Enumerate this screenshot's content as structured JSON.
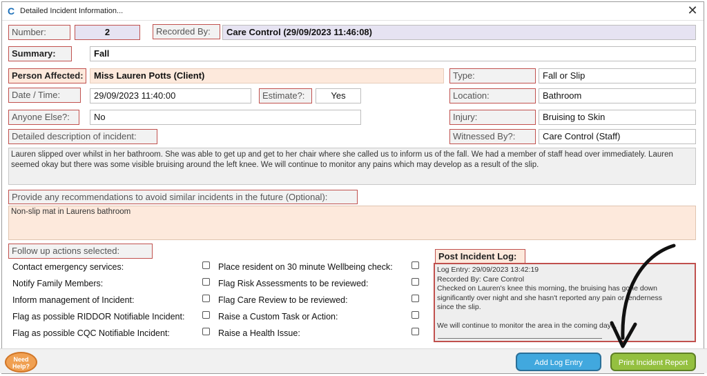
{
  "window": {
    "title": "Detailed Incident Information...",
    "close_glyph": "✕",
    "app_icon": "app-logo-icon"
  },
  "fields": {
    "number_label": "Number:",
    "number_value": "2",
    "recorded_by_label": "Recorded By:",
    "recorded_by_value": "Care Control (29/09/2023 11:46:08)",
    "summary_label": "Summary:",
    "summary_value": "Fall",
    "person_label": "Person Affected:",
    "person_value": "Miss Lauren Potts (Client)",
    "type_label": "Type:",
    "type_value": "Fall or Slip",
    "datetime_label": "Date / Time:",
    "datetime_value": "29/09/2023 11:40:00",
    "estimate_label": "Estimate?:",
    "estimate_value": "Yes",
    "location_label": "Location:",
    "location_value": "Bathroom",
    "anyone_label": "Anyone Else?:",
    "anyone_value": "No",
    "injury_label": "Injury:",
    "injury_value": "Bruising to Skin",
    "description_label": "Detailed description of incident:",
    "witnessed_label": "Witnessed By?:",
    "witnessed_value": "Care Control (Staff)"
  },
  "description_text": "Lauren slipped over whilst in her bathroom. She was able to get up and get to her chair where she called us to inform us of the fall. We had a member of staff head over immediately. Lauren seemed okay but there was some visible bruising around the left knee. We will continue to monitor any pains which may develop as a result of the slip.",
  "recommendations": {
    "label": "Provide any recommendations to avoid similar incidents in the future (Optional):",
    "value": "Non-slip mat in Laurens bathroom"
  },
  "followup": {
    "label": "Follow up actions selected:",
    "left": [
      "Contact emergency services:",
      "Notify Family Members:",
      "Inform management of Incident:",
      "Flag as possible RIDDOR Notifiable Incident:",
      "Flag as possible CQC Notifiable Incident:"
    ],
    "right": [
      "Place resident on 30 minute Wellbeing check:",
      "Flag Risk Assessments to be reviewed:",
      "Flag Care Review to be reviewed:",
      "Raise a Custom Task or Action:",
      "Raise a Health Issue:"
    ]
  },
  "post_log": {
    "label": "Post Incident Log:",
    "lines": [
      "Log Entry: 29/09/2023 13:42:19",
      "Recorded By: Care Control",
      "Checked on Lauren's knee this morning, the bruising has gone down",
      "significantly over night and she hasn't reported any pain or tenderness",
      "since the slip.",
      "",
      "We will continue to monitor the area in the coming days."
    ]
  },
  "footer": {
    "need_help": "Need Help?",
    "add_log": "Add Log Entry",
    "print": "Print Incident Report"
  },
  "colors": {
    "label_border": "#c0504d",
    "peach": "#fde9dc",
    "lavender": "#e6e3f2",
    "blue_button": "#41a8de",
    "green_button": "#94c040"
  }
}
